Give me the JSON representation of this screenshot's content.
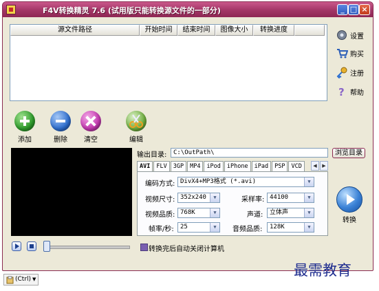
{
  "window": {
    "title": "F4V转换精灵 7.6 (试用版只能转换源文件的一部分)",
    "min_symbol": "_",
    "max_symbol": "□",
    "close_symbol": "×"
  },
  "file_list": {
    "columns": [
      "源文件路径",
      "开始时间",
      "结束时间",
      "图像大小",
      "转换进度"
    ]
  },
  "side_menu": {
    "settings": "设置",
    "buy": "购买",
    "register": "注册",
    "help": "帮助"
  },
  "actions": {
    "add": "添加",
    "delete": "删除",
    "clear": "清空",
    "edit": "编辑"
  },
  "output": {
    "label": "输出目录:",
    "path": "C:\\OutPath\\",
    "browse": "浏览目录"
  },
  "format_tabs": [
    "AVI",
    "FLV",
    "3GP",
    "MP4",
    "iPod",
    "iPhone",
    "iPad",
    "PSP",
    "VCD"
  ],
  "active_tab": "AVI",
  "settings": {
    "encoding_label": "编码方式:",
    "encoding_value": "DivX4+MP3格式 (*.avi)",
    "size_label": "视频尺寸:",
    "size_value": "352x240",
    "quality_label": "视频品质:",
    "quality_value": "768K",
    "fps_label": "帧率/秒:",
    "fps_value": "25",
    "samplerate_label": "采样率:",
    "samplerate_value": "44100",
    "channel_label": "声道:",
    "channel_value": "立体声",
    "audio_quality_label": "音频品质:",
    "audio_quality_value": "128K"
  },
  "convert_label": "转换",
  "shutdown_label": "转换完后自动关闭计算机",
  "watermark": "最需教育",
  "ctrl_popup": "(Ctrl)",
  "colors": {
    "titlebar": "#a23566",
    "window_bg": "#ece9d8",
    "add": "#2e9c2b",
    "delete": "#2f6fcf",
    "clear": "#c43ab1"
  }
}
